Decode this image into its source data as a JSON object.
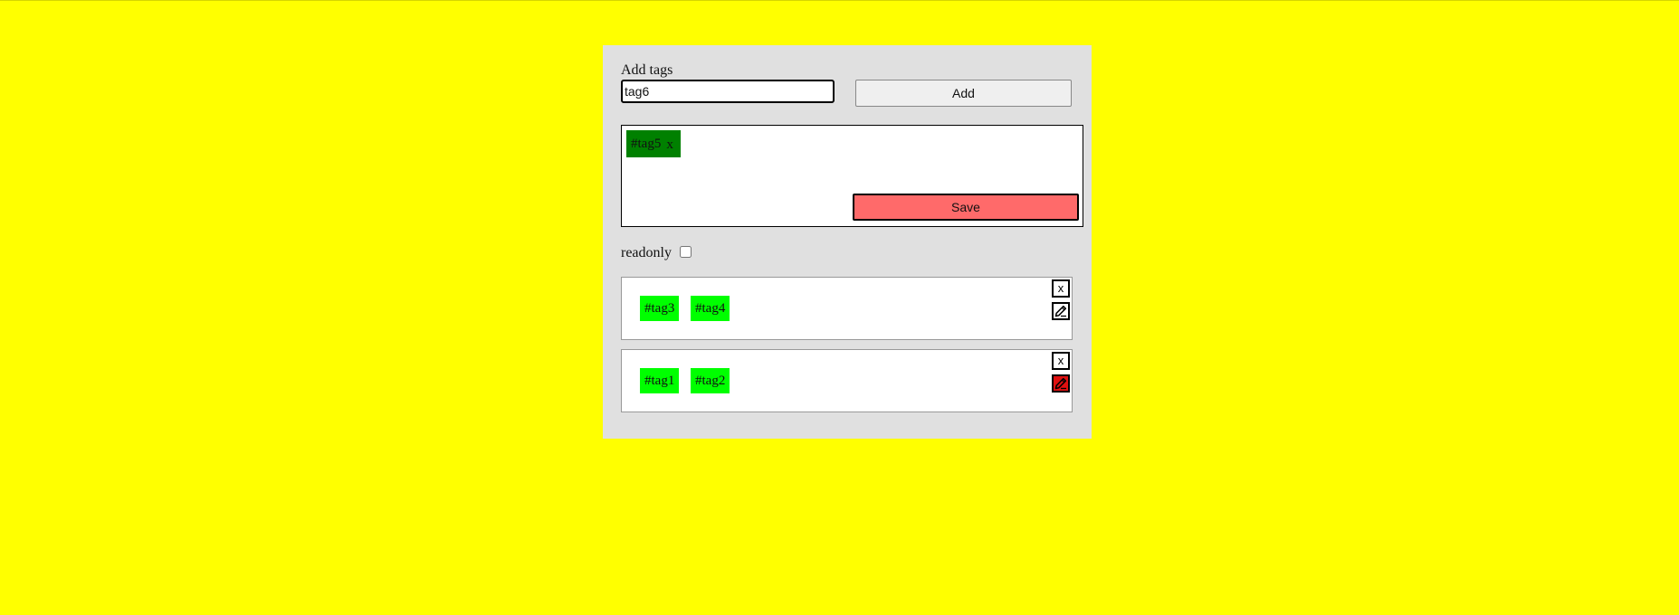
{
  "form": {
    "label": "Add tags",
    "input_value": "tag6",
    "add_label": "Add"
  },
  "editor": {
    "tags": [
      {
        "text": "#tag5",
        "remove": "x"
      }
    ],
    "save_label": "Save"
  },
  "readonly": {
    "label": "readonly",
    "checked": false
  },
  "saved_rows": [
    {
      "tags": [
        "#tag3",
        "#tag4"
      ],
      "close": "x",
      "edit_icon": "pencil-icon",
      "editing": false
    },
    {
      "tags": [
        "#tag1",
        "#tag2"
      ],
      "close": "x",
      "edit_icon": "pencil-icon",
      "editing": true
    }
  ],
  "colors": {
    "page_background": "#ffff00",
    "panel_background": "#e0e0e0",
    "active_tag": "#008000",
    "saved_tag": "#00ff00",
    "save_button": "#ff6a6a",
    "edit_active": "#e01010"
  }
}
